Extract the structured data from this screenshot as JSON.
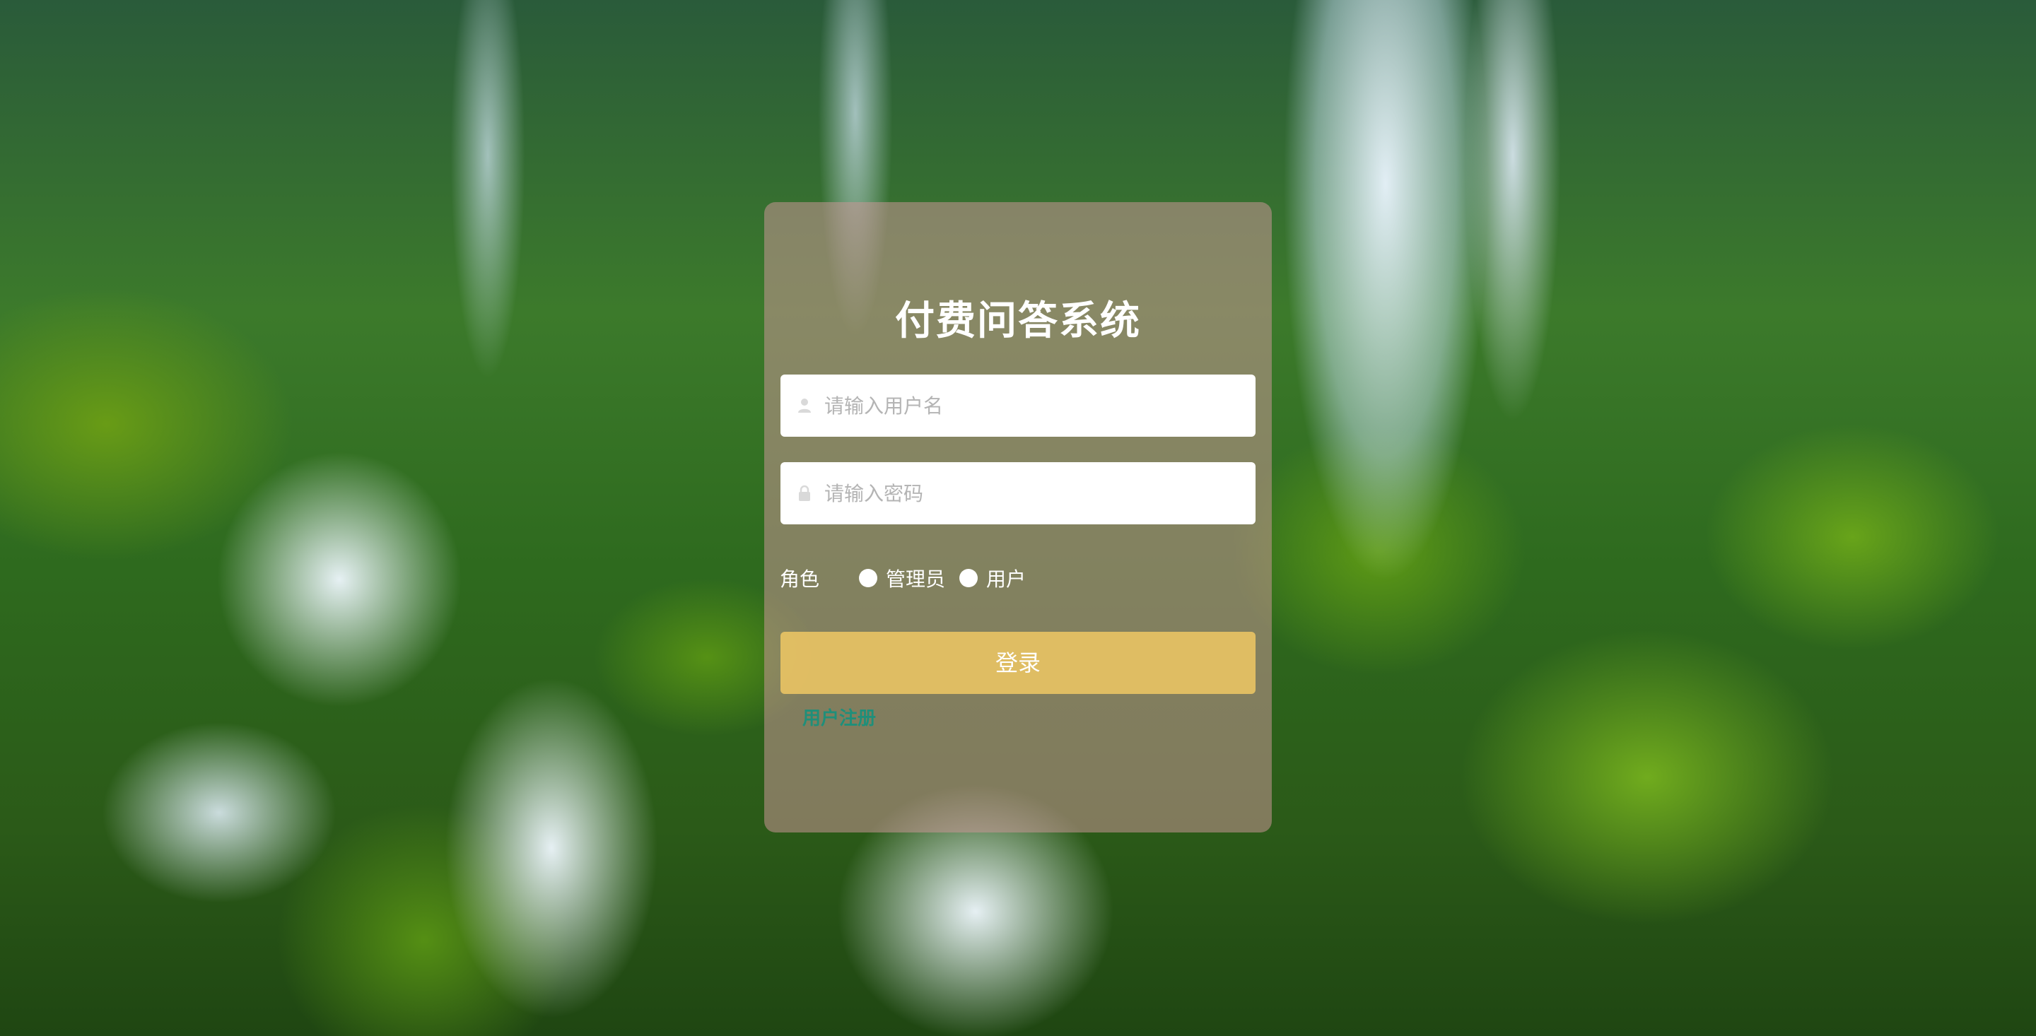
{
  "app": {
    "title": "付费问答系统"
  },
  "form": {
    "username_placeholder": "请输入用户名",
    "password_placeholder": "请输入密码",
    "role_label": "角色",
    "roles": [
      "管理员",
      "用户"
    ],
    "login_button": "登录",
    "register_link": "用户注册"
  },
  "icons": {
    "username": "user-icon",
    "password": "lock-icon"
  },
  "colors": {
    "card_bg": "#c89696",
    "login_button": "#f0c864",
    "register_link": "#1f8f7a"
  }
}
